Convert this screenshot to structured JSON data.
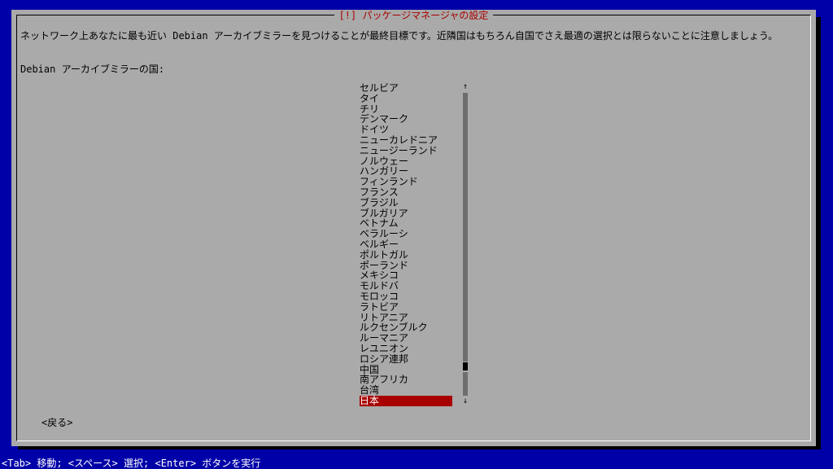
{
  "dialog": {
    "title": "[!] パッケージマネージャの設定",
    "description": "ネットワーク上あなたに最も近い Debian アーカイブミラーを見つけることが最終目標です。近隣国はもちろん自国でさえ最適の選択とは限らないことに注意しましょう。",
    "prompt": "Debian アーカイブミラーの国:",
    "countries": [
      "セルビア",
      "タイ",
      "チリ",
      "デンマーク",
      "ドイツ",
      "ニューカレドニア",
      "ニュージーランド",
      "ノルウェー",
      "ハンガリー",
      "フィンランド",
      "フランス",
      "ブラジル",
      "ブルガリア",
      "ベトナム",
      "ベラルーシ",
      "ベルギー",
      "ポルトガル",
      "ポーランド",
      "メキシコ",
      "モルドバ",
      "モロッコ",
      "ラトビア",
      "リトアニア",
      "ルクセンブルク",
      "ルーマニア",
      "レユニオン",
      "ロシア連邦",
      "中国",
      "南アフリカ",
      "台湾",
      "日本"
    ],
    "selected_country": "日本",
    "scroll_up": "↑",
    "scroll_down": "↓",
    "back_button": "<戻る>"
  },
  "statusbar": {
    "text": "<Tab> 移動; <スペース> 選択; <Enter> ボタンを実行"
  }
}
